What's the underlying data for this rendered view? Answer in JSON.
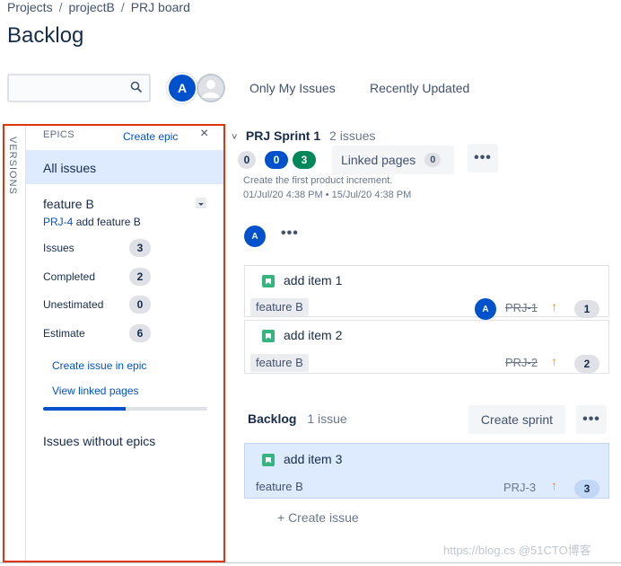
{
  "breadcrumb": {
    "items": [
      "Projects",
      "projectB",
      "PRJ board"
    ],
    "separator": "/"
  },
  "page": {
    "title": "Backlog"
  },
  "search": {
    "placeholder": "",
    "icon": "search-icon"
  },
  "toolbar": {
    "avatar_initial": "A",
    "filters": [
      "Only My Issues",
      "Recently Updated"
    ]
  },
  "sidebar": {
    "versions_tab": "VERSIONS",
    "epics_header": "EPICS",
    "create_epic": "Create epic",
    "close": "×",
    "all_issues": "All issues",
    "epic": {
      "name": "feature B",
      "key": "PRJ-4",
      "summary": "add feature B",
      "stats": [
        {
          "label": "Issues",
          "value": "3"
        },
        {
          "label": "Completed",
          "value": "2"
        },
        {
          "label": "Unestimated",
          "value": "0"
        },
        {
          "label": "Estimate",
          "value": "6"
        }
      ],
      "create_issue_link": "Create issue in epic",
      "view_linked_link": "View linked pages",
      "progress_fraction": 0.5
    },
    "issues_without_epics": "Issues without epics"
  },
  "sprint": {
    "name": "PRJ Sprint 1",
    "issue_count": "2 issues",
    "counts": {
      "todo": "0",
      "in_progress": "0",
      "done": "3"
    },
    "linked_pages_label": "Linked pages",
    "linked_pages_count": "0",
    "more": "•••",
    "goal": "Create the first product increment.",
    "dates": "01/Jul/20 4:38 PM • 15/Jul/20 4:38 PM",
    "assignee_initial": "A",
    "issues": [
      {
        "summary": "add item 1",
        "epic": "feature B",
        "key": "PRJ-1",
        "estimate": "1",
        "assignee": "A",
        "priority_glyph": "↑"
      },
      {
        "summary": "add item 2",
        "epic": "feature B",
        "key": "PRJ-2",
        "estimate": "2",
        "assignee": "",
        "priority_glyph": "↑"
      }
    ]
  },
  "backlog": {
    "name": "Backlog",
    "issue_count": "1 issue",
    "create_sprint": "Create sprint",
    "more": "•••",
    "issues": [
      {
        "summary": "add item 3",
        "epic": "feature B",
        "key": "PRJ-3",
        "estimate": "3",
        "priority_glyph": "↑"
      }
    ],
    "create_issue": "+ Create issue"
  },
  "watermark": "https://blog.cs @51CTO博客",
  "colors": {
    "accent": "#0052cc",
    "selected_bg": "#deebff",
    "highlight_border": "#de350b",
    "done_green": "#36b37e",
    "priority_orange": "#ff8b00"
  }
}
